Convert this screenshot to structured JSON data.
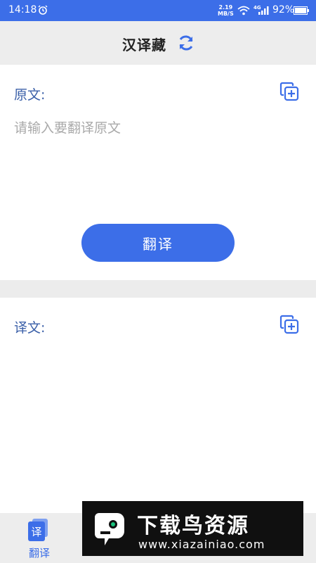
{
  "status_bar": {
    "time": "14:18",
    "speed_value": "2.19",
    "speed_unit": "MB/S",
    "network": "4G",
    "battery": "92%"
  },
  "header": {
    "title": "汉译藏"
  },
  "source": {
    "label": "原文:",
    "placeholder": "请输入要翻译原文",
    "value": "",
    "translate_button": "翻译"
  },
  "target": {
    "label": "译文:",
    "result": ""
  },
  "bottom_nav": {
    "tab_translate_label": "翻译",
    "tab_translate_icon_char": "译"
  },
  "ad": {
    "title": "下载鸟资源",
    "url": "www.xiazainiao.com"
  },
  "colors": {
    "accent": "#3c6ee8",
    "label": "#3a5fa8",
    "background": "#ececec"
  },
  "icons": [
    "alarm-icon",
    "wifi-icon",
    "signal-icon",
    "battery-icon",
    "swap-icon",
    "copy-icon",
    "translate-tab-icon"
  ]
}
